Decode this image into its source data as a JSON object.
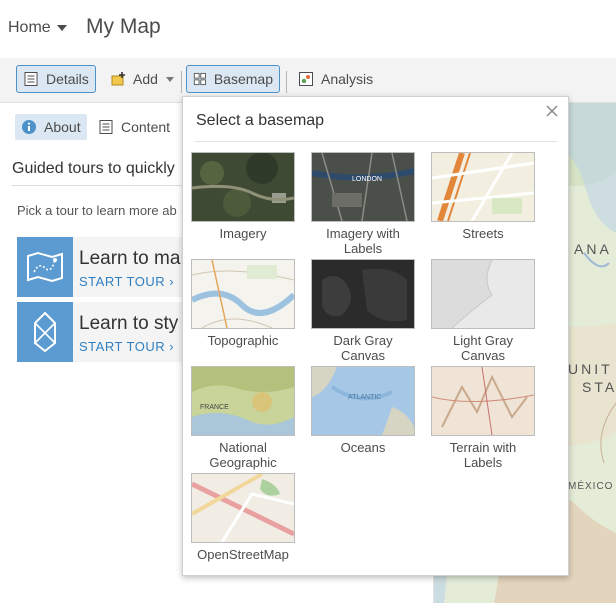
{
  "header": {
    "home_label": "Home",
    "map_title": "My Map"
  },
  "toolbar": {
    "details_label": "Details",
    "add_label": "Add",
    "basemap_label": "Basemap",
    "analysis_label": "Analysis"
  },
  "left_panel": {
    "tabs": [
      {
        "label": "About"
      },
      {
        "label": "Content"
      }
    ],
    "guided_heading": "Guided tours to quickly",
    "pick_text": "Pick a tour to learn more ab",
    "tours": [
      {
        "title": "Learn to ma",
        "link": "START TOUR ›"
      },
      {
        "title": "Learn to sty",
        "link": "START TOUR ›"
      }
    ]
  },
  "map_labels": {
    "canada": "ANA",
    "united": "UNIT",
    "states": "STA",
    "mexico": "MÉXICO"
  },
  "basemap_popup": {
    "title": "Select a basemap",
    "items": [
      {
        "label": "Imagery"
      },
      {
        "label": "Imagery with Labels"
      },
      {
        "label": "Streets"
      },
      {
        "label": "Topographic"
      },
      {
        "label": "Dark Gray Canvas"
      },
      {
        "label": "Light Gray Canvas"
      },
      {
        "label": "National Geographic"
      },
      {
        "label": "Oceans"
      },
      {
        "label": "Terrain with Labels"
      },
      {
        "label": "OpenStreetMap"
      }
    ]
  },
  "colors": {
    "accent": "#4c92c9",
    "active_bg": "#dbe7f2",
    "tour_tile": "#5b9bd1",
    "link": "#2f7fc1"
  }
}
